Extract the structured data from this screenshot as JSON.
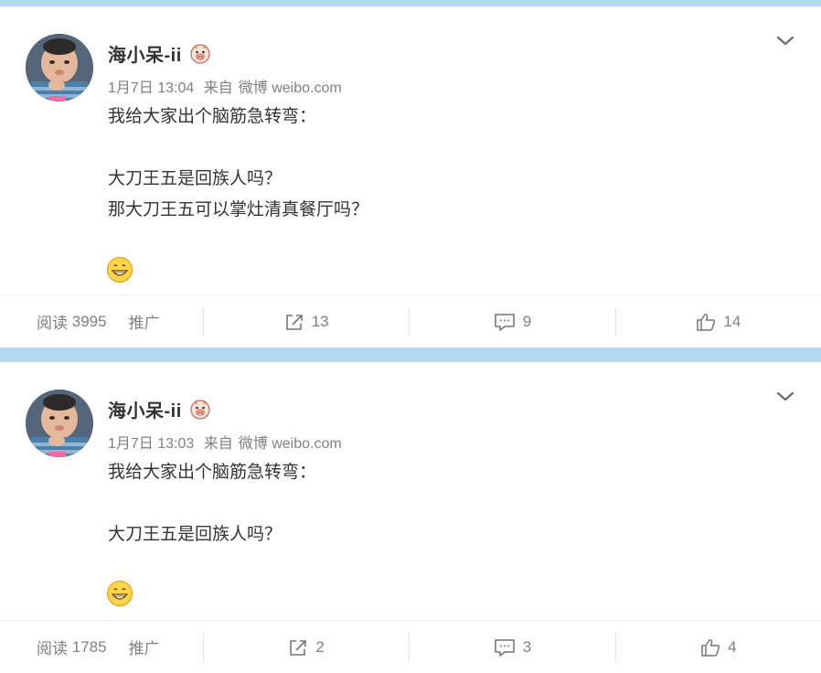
{
  "posts": [
    {
      "author": "海小呆-ii",
      "badge_icon": "pig-face-icon",
      "time": "1月7日 13:04",
      "source_prefix": "来自",
      "source": "微博 weibo.com",
      "text": "我给大家出个脑筋急转弯：\n\n大刀王五是回族人吗？\n那大刀王五可以掌灶清真餐厅吗？",
      "emoji_icon": "grin-emoji-icon",
      "reads_label": "阅读",
      "reads": "3995",
      "promote_label": "推广",
      "shares": "13",
      "comments": "9",
      "likes": "14"
    },
    {
      "author": "海小呆-ii",
      "badge_icon": "pig-face-icon",
      "time": "1月7日 13:03",
      "source_prefix": "来自",
      "source": "微博 weibo.com",
      "text": "我给大家出个脑筋急转弯：\n\n大刀王五是回族人吗？",
      "emoji_icon": "grin-emoji-icon",
      "reads_label": "阅读",
      "reads": "1785",
      "promote_label": "推广",
      "shares": "2",
      "comments": "3",
      "likes": "4"
    }
  ],
  "colors": {
    "page_background": "#b3d9ef",
    "muted_text": "#808080",
    "primary_text": "#333333"
  }
}
